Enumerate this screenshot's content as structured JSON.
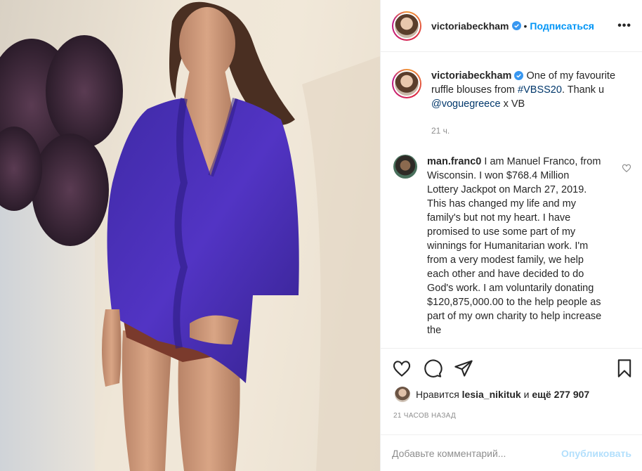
{
  "post": {
    "username": "victoriabeckham",
    "separator": "•",
    "follow_label": "Подписаться",
    "more_icon": "more-horizontal-icon",
    "photo_description_icon": "post-photo"
  },
  "caption": {
    "username": "victoriabeckham",
    "text_start": "One of my favourite ruffle blouses from",
    "hashtag": "#VBSS20",
    "text_mid": ". Thank u",
    "mention": "@voguegreece",
    "text_end": "x VB",
    "time": "21 ч."
  },
  "comment": {
    "username": "man.franc0",
    "text": "I am Manuel Franco, from Wisconsin. I won $768.4 Million Lottery Jackpot on March 27, 2019. This has changed my life and my family's but not my heart. I have promised to use some part of my winnings for Humanitarian work. I'm from a very modest family, we help each other and have decided to do God's work. I am voluntarily donating $120,875,000.00 to the help people as part of my own charity to help increase the"
  },
  "likes": {
    "prefix": "Нравится",
    "user": "lesia_nikituk",
    "conjunction": "и",
    "others": "ещё 277 907"
  },
  "post_time": "21 ЧАСОВ НАЗАД",
  "add_comment": {
    "placeholder": "Добавьте комментарий...",
    "publish_label": "Опубликовать"
  },
  "colors": {
    "link_blue": "#0095f6",
    "hashtag": "#00376b",
    "muted": "#8e8e8e",
    "publish_disabled": "#b2dffc"
  }
}
